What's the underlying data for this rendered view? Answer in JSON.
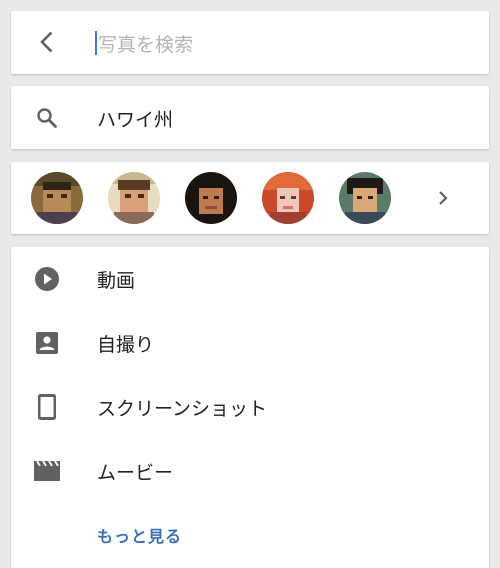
{
  "search": {
    "placeholder": "写真を検索",
    "back_icon": "arrow-back-icon"
  },
  "suggestion": {
    "icon": "search-icon",
    "label": "ハワイ州"
  },
  "people": {
    "avatars": [
      {
        "name": "person-1"
      },
      {
        "name": "person-2"
      },
      {
        "name": "person-3"
      },
      {
        "name": "person-4"
      },
      {
        "name": "person-5"
      }
    ],
    "more_icon": "chevron-right-icon"
  },
  "categories": {
    "items": [
      {
        "icon": "play-circle-icon",
        "label": "動画"
      },
      {
        "icon": "portrait-icon",
        "label": "自撮り"
      },
      {
        "icon": "smartphone-icon",
        "label": "スクリーンショット"
      },
      {
        "icon": "movie-clapper-icon",
        "label": "ムービー"
      }
    ],
    "more_label": "もっと見る"
  },
  "colors": {
    "icon": "#616161",
    "accent_link": "#3d6fb8",
    "caret": "#3b78e7",
    "background": "#e9e9e9"
  }
}
